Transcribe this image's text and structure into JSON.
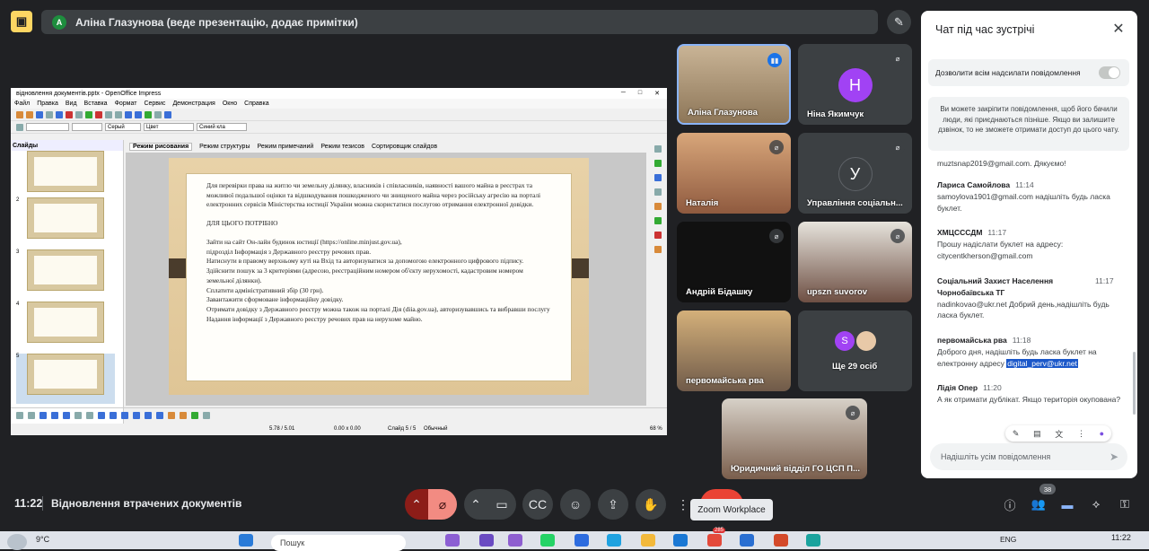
{
  "header": {
    "presenter_avatar_letter": "А",
    "presenting_text": "Аліна Глазунова (веде презентацію, додає примітки)"
  },
  "oo": {
    "window_title": "відновлення документів.pptx - OpenOffice Impress",
    "menu": [
      "Файл",
      "Правка",
      "Вид",
      "Вставка",
      "Формат",
      "Сервис",
      "Демонстрация",
      "Окно",
      "Справка"
    ],
    "toolbar": {
      "line_color": "Серый",
      "area_label": "Цвет",
      "area_color": "Синий кла"
    },
    "slides_header": "Слайды",
    "slide_numbers": [
      "2",
      "3",
      "4",
      "5"
    ],
    "view_tabs": [
      "Режим рисования",
      "Режим структуры",
      "Режим примечаний",
      "Режим тезисов",
      "Сортировщик слайдов"
    ],
    "slide_paragraph": "Для перевірки права на житло чи земельну ділянку, власників і співласни­ків, наявності вашого майна в реєстрах та можливої подальшої оцінки та відшко­дування пошкодженого чи знищеного майна через російську агресію на порталі електронних сервісів Міністерства юстиції України можна скористатися послугою отримання електронної довідки.",
    "slide_heading": "ДЛЯ ЦЬОГО ПОТРІБНО",
    "slide_steps": [
      "Зайти на сайт Он-лайн будинок юстиції (https://online.minjust.gov.ua),",
      "підрозділ Інформація з Державного реєстру речових прав.",
      "Натиснути в правому верхньому куті на Вхід та авторизуватися за допо­могою електронного цифрового підпису.",
      "Здійснити пошук за 3 критеріями (адресою, реєстраційним номером об'єкту нерухомості, кадастровим номером земельної ділянки).",
      "Сплатити адміністративний збір (30 грн).",
      "Завантажити сформоване інформаційну довідку.",
      "Отримати довідку з Державного реєстру можна також на порталі Дія (diia.gov.ua), авторизувавшись та вибравши послугу Надання інформації з Дер­жавного реєстру речових прав на нерухоме майно."
    ],
    "status": {
      "position": "5.78 / 5.01",
      "size": "0.00 x 0.00",
      "slide": "Слайд 5 / 5",
      "layout": "Обычный",
      "zoom": "68 %"
    }
  },
  "tiles": [
    {
      "name": "Аліна Глазунова",
      "muted": false
    },
    {
      "name": "Ніна Якимчук",
      "avatar": "Н",
      "color": "#a142f4",
      "muted": true
    },
    {
      "name": "Наталія",
      "muted": true
    },
    {
      "name": "Управління соціальн...",
      "avatar": "У",
      "color": "#3c4043",
      "muted": true
    },
    {
      "name": "Андрій Бідашку",
      "muted": true
    },
    {
      "name": "upszn suvorov",
      "muted": true
    },
    {
      "name": "первомайська рва",
      "muted": false
    },
    {
      "name": "Ще 29 осіб",
      "avatar": "S",
      "color": "#a142f4",
      "muted": false
    },
    {
      "name": "Юридичний відділ ГО ЦСП П...",
      "muted": true
    }
  ],
  "chat": {
    "title": "Чат під час зустрічі",
    "allow_label": "Дозволити всім надсилати повідомлення",
    "pin_note": "Ви можете закріпити повідомлення, щоб його бачили люди, які приєднаються пізніше. Якщо ви залишите дзвінок, то не зможете отримати доступ до цього чату.",
    "messages": [
      {
        "sender": "",
        "time": "",
        "text": "muztsnap2019@gmail.com.  Дякуємо!"
      },
      {
        "sender": "Лариса Самойлова",
        "time": "11:14",
        "text": "samoylova1901@gmail.com надішліть будь ласка буклет."
      },
      {
        "sender": "ХМЦСССДМ",
        "time": "11:17",
        "text": "Прошу надіслати буклет на адресу: citycentkherson@gmail.com"
      },
      {
        "sender": "Соціальний Захист Населення Чорнобаївська ТГ",
        "time": "11:17",
        "text": "nadinkovao@ukr.net  Добрий день,надішліть будь ласка буклет."
      },
      {
        "sender": "первомайська рва",
        "time": "11:18",
        "text": "Доброго дня, надішліть будь ласка буклет на електронну адресу ",
        "highlight": "digital_perv@ukr.net"
      },
      {
        "sender": "Лідія Опер",
        "time": "11:20",
        "text": "А як отримати дублікат. Якщо територія окупована?"
      }
    ],
    "input_placeholder": "Надішліть усім повідомлення"
  },
  "bottom": {
    "time": "11:22",
    "meeting_title": "Відновлення втрачених документів",
    "tooltip": "Zoom Workplace",
    "people_count": "38"
  },
  "taskbar": {
    "temperature": "9°C",
    "search_placeholder": "Пошук",
    "lang": "ENG",
    "clock": "11:22",
    "badge": "285"
  }
}
